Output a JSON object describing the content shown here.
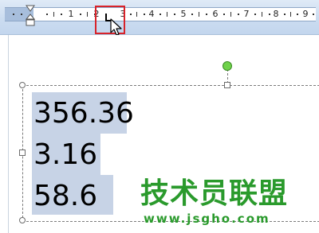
{
  "ruler": {
    "numbers": [
      "1",
      "2",
      "3",
      "4",
      "5",
      "6",
      "7",
      "8",
      "9"
    ],
    "tab_stop_icon": "left-tab-stop-icon",
    "indent_icon": "hanging-indent-marker-icon"
  },
  "textbox": {
    "lines": [
      "356.36",
      "3.16",
      "58.6"
    ]
  },
  "watermark": {
    "text": "技术员联盟",
    "url": "www.jsgho.com"
  },
  "colors": {
    "ruler_bg": "#cbdcf0",
    "selection": "#c7d3e6",
    "highlight_box": "#d8232a",
    "rotate_handle": "#6fd24a",
    "watermark": "#2a9a2c"
  }
}
